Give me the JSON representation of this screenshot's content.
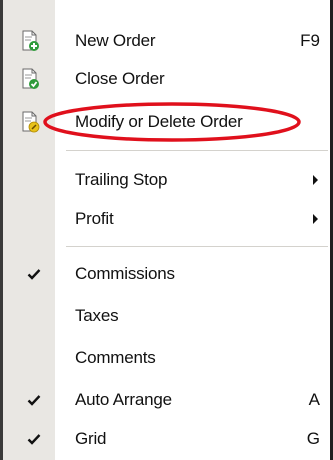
{
  "menu": {
    "items": [
      {
        "label": "New Order",
        "shortcut": "F9",
        "icon": "new-order-icon"
      },
      {
        "label": "Close Order",
        "icon": "close-order-icon"
      },
      {
        "label": "Modify or Delete Order",
        "icon": "modify-order-icon"
      },
      {
        "label": "Trailing Stop",
        "submenu": true
      },
      {
        "label": "Profit",
        "submenu": true
      },
      {
        "label": "Commissions",
        "checked": true
      },
      {
        "label": "Taxes",
        "checked": false
      },
      {
        "label": "Comments",
        "checked": false
      },
      {
        "label": "Auto Arrange",
        "shortcut": "A",
        "checked": true
      },
      {
        "label": "Grid",
        "shortcut": "G",
        "checked": true
      }
    ]
  },
  "colors": {
    "annotation_ellipse": "#e0101c",
    "gutter": "#e9e7e3",
    "icon_green": "#2e9a3a",
    "icon_yellow": "#e8c21a"
  }
}
